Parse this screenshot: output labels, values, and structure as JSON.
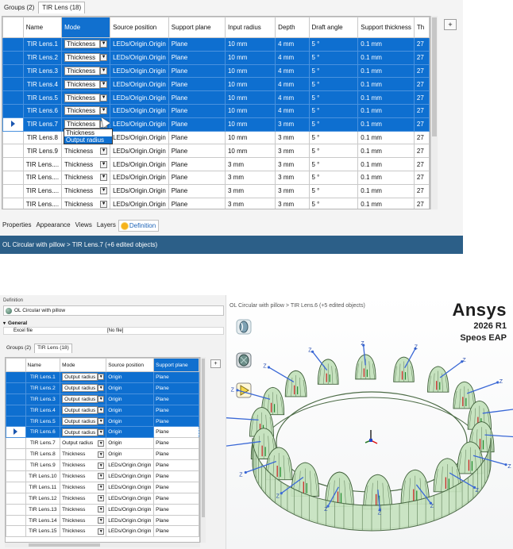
{
  "top": {
    "tabs": [
      "Groups (2)",
      "TIR Lens (18)"
    ],
    "columns": [
      "Name",
      "Mode",
      "Source position",
      "Support plane",
      "Input radius",
      "Depth",
      "Draft angle",
      "Support thickness",
      "Th"
    ],
    "rows": [
      {
        "name": "TIR Lens.1",
        "mode": "Thickness",
        "source": "LEDs/Origin.Origin",
        "plane": "Plane",
        "radius": "10 mm",
        "depth": "4 mm",
        "draft": "5 °",
        "thick": "0.1 mm",
        "th": "27",
        "sel": true
      },
      {
        "name": "TIR Lens.2",
        "mode": "Thickness",
        "source": "LEDs/Origin.Origin",
        "plane": "Plane",
        "radius": "10 mm",
        "depth": "4 mm",
        "draft": "5 °",
        "thick": "0.1 mm",
        "th": "27",
        "sel": true
      },
      {
        "name": "TIR Lens.3",
        "mode": "Thickness",
        "source": "LEDs/Origin.Origin",
        "plane": "Plane",
        "radius": "10 mm",
        "depth": "4 mm",
        "draft": "5 °",
        "thick": "0.1 mm",
        "th": "27",
        "sel": true
      },
      {
        "name": "TIR Lens.4",
        "mode": "Thickness",
        "source": "LEDs/Origin.Origin",
        "plane": "Plane",
        "radius": "10 mm",
        "depth": "4 mm",
        "draft": "5 °",
        "thick": "0.1 mm",
        "th": "27",
        "sel": true
      },
      {
        "name": "TIR Lens.5",
        "mode": "Thickness",
        "source": "LEDs/Origin.Origin",
        "plane": "Plane",
        "radius": "10 mm",
        "depth": "4 mm",
        "draft": "5 °",
        "thick": "0.1 mm",
        "th": "27",
        "sel": true
      },
      {
        "name": "TIR Lens.6",
        "mode": "Thickness",
        "source": "LEDs/Origin.Origin",
        "plane": "Plane",
        "radius": "10 mm",
        "depth": "4 mm",
        "draft": "5 °",
        "thick": "0.1 mm",
        "th": "27",
        "sel": true
      },
      {
        "name": "TIR Lens.7",
        "mode": "Thickness",
        "source": "LEDs/Origin.Origin",
        "plane": "Plane",
        "radius": "10 mm",
        "depth": "3 mm",
        "draft": "5 °",
        "thick": "0.1 mm",
        "th": "27",
        "sel": true,
        "cur": true
      },
      {
        "name": "TIR Lens.8",
        "mode": "",
        "source": "LEDs/Origin.Origin",
        "plane": "Plane",
        "radius": "10 mm",
        "depth": "3 mm",
        "draft": "5 °",
        "thick": "0.1 mm",
        "th": "27",
        "sel": false
      },
      {
        "name": "TIR Lens.9",
        "mode": "Thickness",
        "source": "LEDs/Origin.Origin",
        "plane": "Plane",
        "radius": "10 mm",
        "depth": "3 mm",
        "draft": "5 °",
        "thick": "0.1 mm",
        "th": "27",
        "sel": false
      },
      {
        "name": "TIR Lens....",
        "mode": "Thickness",
        "source": "LEDs/Origin.Origin",
        "plane": "Plane",
        "radius": "3 mm",
        "depth": "3 mm",
        "draft": "5 °",
        "thick": "0.1 mm",
        "th": "27",
        "sel": false
      },
      {
        "name": "TIR Lens....",
        "mode": "Thickness",
        "source": "LEDs/Origin.Origin",
        "plane": "Plane",
        "radius": "3 mm",
        "depth": "3 mm",
        "draft": "5 °",
        "thick": "0.1 mm",
        "th": "27",
        "sel": false
      },
      {
        "name": "TIR Lens....",
        "mode": "Thickness",
        "source": "LEDs/Origin.Origin",
        "plane": "Plane",
        "radius": "3 mm",
        "depth": "3 mm",
        "draft": "5 °",
        "thick": "0.1 mm",
        "th": "27",
        "sel": false
      },
      {
        "name": "TIR Lens....",
        "mode": "Thickness",
        "source": "LEDs/Origin.Origin",
        "plane": "Plane",
        "radius": "3 mm",
        "depth": "3 mm",
        "draft": "5 °",
        "thick": "0.1 mm",
        "th": "27",
        "sel": false
      },
      {
        "name": "TIR Lens....",
        "mode": "Thickness",
        "source": "LEDs/Origin.Origin",
        "plane": "Plane",
        "radius": "3 mm",
        "depth": "3 mm",
        "draft": "5 °",
        "thick": "0.1 mm",
        "th": "27",
        "sel": false
      }
    ],
    "dropdown_options": [
      "Thickness",
      "Output radius"
    ],
    "plus_label": "+",
    "bottom_tabs": [
      "Properties",
      "Appearance",
      "Views",
      "Layers",
      "Definition"
    ],
    "status": "OL Circular with pillow > TIR Lens.7 (+6 edited objects)"
  },
  "bottom": {
    "definition_label": "Definition",
    "object_name": "OL Circular with pillow",
    "general_label": "General",
    "excel_label": "Excel file",
    "excel_value": "[No file]",
    "tabs": [
      "Groups (2)",
      "TIR Lens (18)"
    ],
    "columns": [
      "Name",
      "Mode",
      "Source position",
      "Support plane"
    ],
    "rows": [
      {
        "name": "TIR Lens.1",
        "mode": "Output radius",
        "source": "Origin",
        "plane": "Plane",
        "sel": true
      },
      {
        "name": "TIR Lens.2",
        "mode": "Output radius",
        "source": "Origin",
        "plane": "Plane",
        "sel": true
      },
      {
        "name": "TIR Lens.3",
        "mode": "Output radius",
        "source": "Origin",
        "plane": "Plane",
        "sel": true
      },
      {
        "name": "TIR Lens.4",
        "mode": "Output radius",
        "source": "Origin",
        "plane": "Plane",
        "sel": true
      },
      {
        "name": "TIR Lens.5",
        "mode": "Output radius",
        "source": "Origin",
        "plane": "Plane",
        "sel": true
      },
      {
        "name": "TIR Lens.6",
        "mode": "Output radius",
        "source": "Origin",
        "plane": "Plane",
        "sel": true,
        "cur": true,
        "edit": true
      },
      {
        "name": "TIR Lens.7",
        "mode": "Output radius",
        "source": "Origin",
        "plane": "Plane",
        "sel": false
      },
      {
        "name": "TIR Lens.8",
        "mode": "Thickness",
        "source": "Origin",
        "plane": "Plane",
        "sel": false
      },
      {
        "name": "TIR Lens.9",
        "mode": "Thickness",
        "source": "LEDs/Origin.Origin",
        "plane": "Plane",
        "sel": false
      },
      {
        "name": "TIR Lens.10",
        "mode": "Thickness",
        "source": "LEDs/Origin.Origin",
        "plane": "Plane",
        "sel": false
      },
      {
        "name": "TIR Lens.11",
        "mode": "Thickness",
        "source": "LEDs/Origin.Origin",
        "plane": "Plane",
        "sel": false
      },
      {
        "name": "TIR Lens.12",
        "mode": "Thickness",
        "source": "LEDs/Origin.Origin",
        "plane": "Plane",
        "sel": false
      },
      {
        "name": "TIR Lens.13",
        "mode": "Thickness",
        "source": "LEDs/Origin.Origin",
        "plane": "Plane",
        "sel": false
      },
      {
        "name": "TIR Lens.14",
        "mode": "Thickness",
        "source": "LEDs/Origin.Origin",
        "plane": "Plane",
        "sel": false
      },
      {
        "name": "TIR Lens.15",
        "mode": "Thickness",
        "source": "LEDs/Origin.Origin",
        "plane": "Plane",
        "sel": false
      }
    ],
    "plus_label": "+",
    "viewport_breadcrumb": "OL Circular with pillow > TIR Lens.6 (+5 edited objects)",
    "brand": {
      "name": "Ansys",
      "version": "2026 R1",
      "product": "Speos EAP"
    },
    "axis_label": "Z"
  },
  "colors": {
    "selection": "#0e6fd0",
    "status_bar": "#2c5f88",
    "lens_green": "#c7e3c0"
  }
}
